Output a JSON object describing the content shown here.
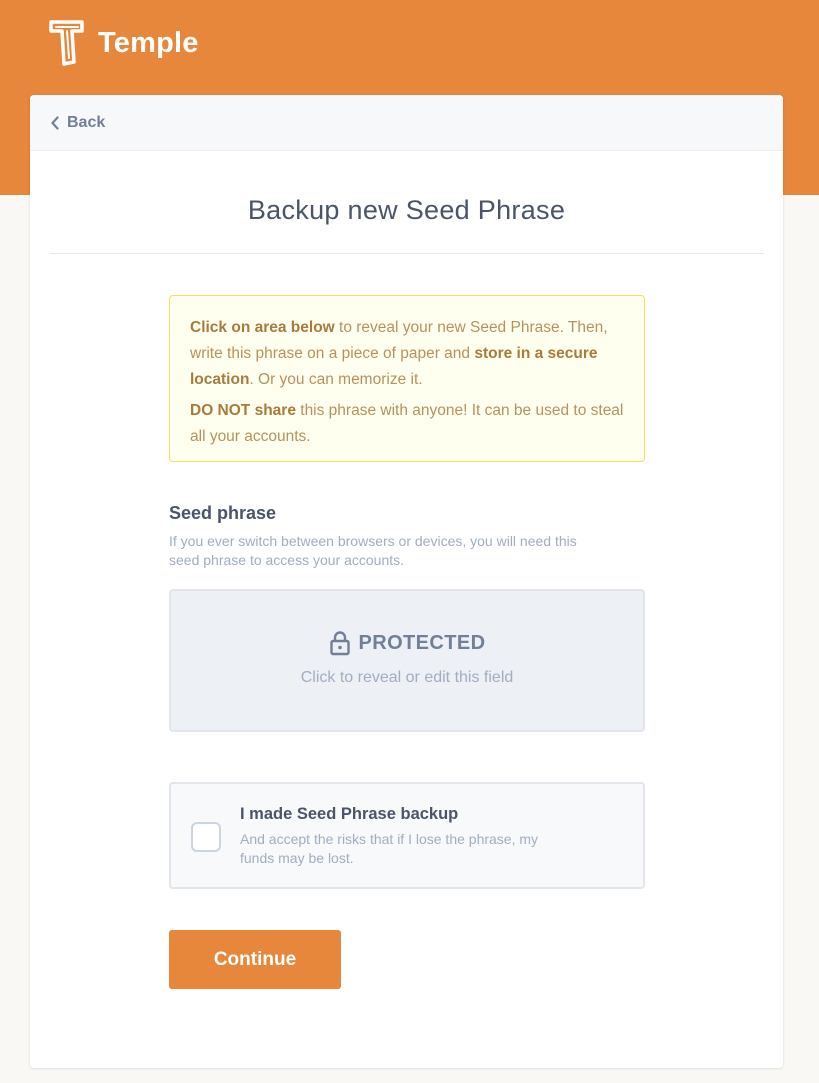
{
  "app": {
    "name": "Temple",
    "brand_color": "#e6873b",
    "logo_icon": "temple-logo-icon"
  },
  "header": {
    "back_label": "Back",
    "back_icon": "chevron-left-icon"
  },
  "page": {
    "title": "Backup new Seed Phrase"
  },
  "notice": {
    "line1_bold": "Click on area below",
    "line1_text": " to reveal your new Seed Phrase. Then, write this phrase on a piece of paper and ",
    "line1_bold2": "store in a secure location",
    "line1_end": ". Or you can memorize it.",
    "line2_bold": "DO NOT share",
    "line2_text": " this phrase with anyone! It can be used to steal all your accounts."
  },
  "seed": {
    "label": "Seed phrase",
    "description": "If you ever switch between browsers or devices, you will need this seed phrase to access your accounts.",
    "protected_icon": "lock-icon",
    "protected_label": "PROTECTED",
    "protected_hint": "Click to reveal or edit this field"
  },
  "backup_checkbox": {
    "checked": false,
    "title": "I made Seed Phrase backup",
    "description": "And accept the risks that if I lose the phrase, my funds may be lost."
  },
  "actions": {
    "continue_label": "Continue"
  }
}
